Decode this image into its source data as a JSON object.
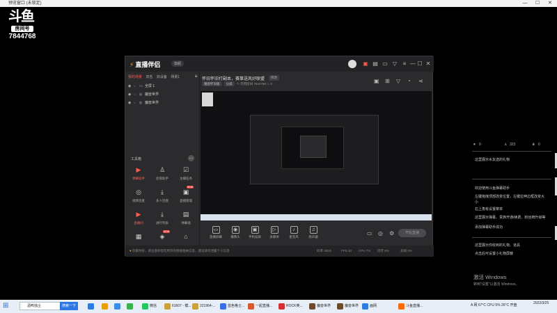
{
  "window": {
    "title": "预览窗口 (未锁定)",
    "close": "✕",
    "maximize": "☐",
    "minimize": "—"
  },
  "logo": {
    "mark": "斗鱼",
    "room_label": "房间号",
    "room_id": "7844768"
  },
  "app": {
    "name": "直播伴侣",
    "badge": "旗舰",
    "scene_tabs": [
      "我的场景",
      "双名",
      "双设备",
      "场景1"
    ],
    "active_scene_tab": 0,
    "add_label": "+",
    "sources": [
      {
        "name": "全屏 1"
      },
      {
        "name": "魔兽世界"
      },
      {
        "name": "魔兽世界"
      }
    ],
    "tools_title": "工具箱",
    "tools_more": "…",
    "tools": [
      {
        "label": "弹幕助手",
        "icon": "▶",
        "active": true
      },
      {
        "label": "房管助手",
        "icon": "♙",
        "active": false
      },
      {
        "label": "主播任务",
        "icon": "☑",
        "active": false
      },
      {
        "label": "视频连麦",
        "icon": "◎",
        "active": false
      },
      {
        "label": "多人连接",
        "icon": "⤓",
        "active": false
      },
      {
        "label": "直播管理",
        "icon": "▣",
        "active": false,
        "new": "NEW"
      },
      {
        "label": "直播间",
        "icon": "▶",
        "active": true
      },
      {
        "label": "进行列表",
        "icon": "⤓",
        "active": false
      },
      {
        "label": "弹幕墙",
        "icon": "▤",
        "active": false
      },
      {
        "label": "",
        "icon": "▦",
        "active": false
      },
      {
        "label": "",
        "icon": "◈",
        "active": false,
        "new": "NEW"
      },
      {
        "label": "",
        "icon": "⌂",
        "active": false
      }
    ],
    "stream_title": "怀旧怀旧打副本，赛事送风好联盟",
    "stream_title_tag": "修改",
    "category_tag": "魔兽怀旧服",
    "category_edit": "分类",
    "room_label": "可用房间",
    "room_number": "7844768",
    "fans": "0",
    "status_text": "玩家你好，请注意你现在所开的频道相关信息，建议请勿泄露个人信息",
    "status_stats": [
      "码率 0kb/s",
      "FPS 30",
      "CPU 7%",
      "内存 8%",
      "丢帧 0%"
    ],
    "bottom_tools": [
      {
        "label": "直播屏幕",
        "icon": "▭"
      },
      {
        "label": "摄像头",
        "icon": "◉"
      },
      {
        "label": "手机投屏",
        "icon": "▣"
      },
      {
        "label": "多媒体",
        "icon": "▷"
      },
      {
        "label": "麦克风",
        "icon": "♪"
      },
      {
        "label": "扬声器",
        "icon": "♫"
      }
    ],
    "go_live": "开始直播"
  },
  "right_panel": {
    "stats": [
      "0",
      "323",
      "0"
    ],
    "pinned": "这里展示水友送的礼物",
    "messages": [
      "欢迎使用斗鱼弹幕助手",
      "左键拖拽顶部改变位置，左键拉伸边框改变大",
      "小",
      "右上角有设置菜单",
      "这里展示弹幕、贵族开通/续费、粉丝牌升级等",
      "添加弹幕助手成功"
    ],
    "gift_lines": [
      "这里展示你收到的礼物、道具",
      "点击后可设置小礼物屏蔽"
    ]
  },
  "activate": {
    "title": "激活 Windows",
    "subtitle": "转到\"设置\"以激活 Windows。"
  },
  "taskbar": {
    "search_placeholder": "酒鸭独尘",
    "search_button": "搜索一下",
    "items": [
      {
        "label": "",
        "color": "#2d7de0"
      },
      {
        "label": "",
        "color": "#e6a000"
      },
      {
        "label": "",
        "color": "#3a8ee6"
      },
      {
        "label": "",
        "color": "#37b24d"
      },
      {
        "label": "微信",
        "color": "#25c55f"
      },
      {
        "label": "61607 - 模...",
        "color": "#c9a23b"
      },
      {
        "label": "221964-...",
        "color": "#c9a23b"
      },
      {
        "label": "蓝色格士...",
        "color": "#3a6ee6"
      },
      {
        "label": "一起直播...",
        "color": "#d85a2b"
      },
      {
        "label": "ROCK英...",
        "color": "#d63031"
      },
      {
        "label": "魔兽世界",
        "color": "#6b4b2a"
      },
      {
        "label": "魔兽世界",
        "color": "#6b4b2a"
      },
      {
        "label": "画网",
        "color": "#2d7de0"
      },
      {
        "label": "斗鱼直播...",
        "color": "#ff6b00"
      }
    ],
    "tray": "A 网 67°C CPU 5% 26°C 开盘",
    "time": "",
    "date": "2022/3/25"
  }
}
